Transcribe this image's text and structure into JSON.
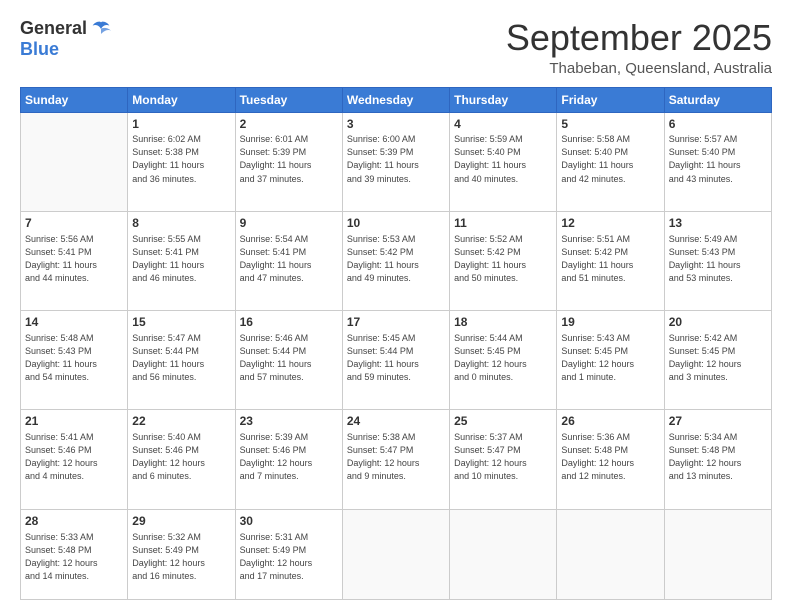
{
  "logo": {
    "general": "General",
    "blue": "Blue"
  },
  "title": "September 2025",
  "location": "Thabeban, Queensland, Australia",
  "days_of_week": [
    "Sunday",
    "Monday",
    "Tuesday",
    "Wednesday",
    "Thursday",
    "Friday",
    "Saturday"
  ],
  "weeks": [
    [
      {
        "day": "",
        "info": ""
      },
      {
        "day": "1",
        "info": "Sunrise: 6:02 AM\nSunset: 5:38 PM\nDaylight: 11 hours\nand 36 minutes."
      },
      {
        "day": "2",
        "info": "Sunrise: 6:01 AM\nSunset: 5:39 PM\nDaylight: 11 hours\nand 37 minutes."
      },
      {
        "day": "3",
        "info": "Sunrise: 6:00 AM\nSunset: 5:39 PM\nDaylight: 11 hours\nand 39 minutes."
      },
      {
        "day": "4",
        "info": "Sunrise: 5:59 AM\nSunset: 5:40 PM\nDaylight: 11 hours\nand 40 minutes."
      },
      {
        "day": "5",
        "info": "Sunrise: 5:58 AM\nSunset: 5:40 PM\nDaylight: 11 hours\nand 42 minutes."
      },
      {
        "day": "6",
        "info": "Sunrise: 5:57 AM\nSunset: 5:40 PM\nDaylight: 11 hours\nand 43 minutes."
      }
    ],
    [
      {
        "day": "7",
        "info": "Sunrise: 5:56 AM\nSunset: 5:41 PM\nDaylight: 11 hours\nand 44 minutes."
      },
      {
        "day": "8",
        "info": "Sunrise: 5:55 AM\nSunset: 5:41 PM\nDaylight: 11 hours\nand 46 minutes."
      },
      {
        "day": "9",
        "info": "Sunrise: 5:54 AM\nSunset: 5:41 PM\nDaylight: 11 hours\nand 47 minutes."
      },
      {
        "day": "10",
        "info": "Sunrise: 5:53 AM\nSunset: 5:42 PM\nDaylight: 11 hours\nand 49 minutes."
      },
      {
        "day": "11",
        "info": "Sunrise: 5:52 AM\nSunset: 5:42 PM\nDaylight: 11 hours\nand 50 minutes."
      },
      {
        "day": "12",
        "info": "Sunrise: 5:51 AM\nSunset: 5:42 PM\nDaylight: 11 hours\nand 51 minutes."
      },
      {
        "day": "13",
        "info": "Sunrise: 5:49 AM\nSunset: 5:43 PM\nDaylight: 11 hours\nand 53 minutes."
      }
    ],
    [
      {
        "day": "14",
        "info": "Sunrise: 5:48 AM\nSunset: 5:43 PM\nDaylight: 11 hours\nand 54 minutes."
      },
      {
        "day": "15",
        "info": "Sunrise: 5:47 AM\nSunset: 5:44 PM\nDaylight: 11 hours\nand 56 minutes."
      },
      {
        "day": "16",
        "info": "Sunrise: 5:46 AM\nSunset: 5:44 PM\nDaylight: 11 hours\nand 57 minutes."
      },
      {
        "day": "17",
        "info": "Sunrise: 5:45 AM\nSunset: 5:44 PM\nDaylight: 11 hours\nand 59 minutes."
      },
      {
        "day": "18",
        "info": "Sunrise: 5:44 AM\nSunset: 5:45 PM\nDaylight: 12 hours\nand 0 minutes."
      },
      {
        "day": "19",
        "info": "Sunrise: 5:43 AM\nSunset: 5:45 PM\nDaylight: 12 hours\nand 1 minute."
      },
      {
        "day": "20",
        "info": "Sunrise: 5:42 AM\nSunset: 5:45 PM\nDaylight: 12 hours\nand 3 minutes."
      }
    ],
    [
      {
        "day": "21",
        "info": "Sunrise: 5:41 AM\nSunset: 5:46 PM\nDaylight: 12 hours\nand 4 minutes."
      },
      {
        "day": "22",
        "info": "Sunrise: 5:40 AM\nSunset: 5:46 PM\nDaylight: 12 hours\nand 6 minutes."
      },
      {
        "day": "23",
        "info": "Sunrise: 5:39 AM\nSunset: 5:46 PM\nDaylight: 12 hours\nand 7 minutes."
      },
      {
        "day": "24",
        "info": "Sunrise: 5:38 AM\nSunset: 5:47 PM\nDaylight: 12 hours\nand 9 minutes."
      },
      {
        "day": "25",
        "info": "Sunrise: 5:37 AM\nSunset: 5:47 PM\nDaylight: 12 hours\nand 10 minutes."
      },
      {
        "day": "26",
        "info": "Sunrise: 5:36 AM\nSunset: 5:48 PM\nDaylight: 12 hours\nand 12 minutes."
      },
      {
        "day": "27",
        "info": "Sunrise: 5:34 AM\nSunset: 5:48 PM\nDaylight: 12 hours\nand 13 minutes."
      }
    ],
    [
      {
        "day": "28",
        "info": "Sunrise: 5:33 AM\nSunset: 5:48 PM\nDaylight: 12 hours\nand 14 minutes."
      },
      {
        "day": "29",
        "info": "Sunrise: 5:32 AM\nSunset: 5:49 PM\nDaylight: 12 hours\nand 16 minutes."
      },
      {
        "day": "30",
        "info": "Sunrise: 5:31 AM\nSunset: 5:49 PM\nDaylight: 12 hours\nand 17 minutes."
      },
      {
        "day": "",
        "info": ""
      },
      {
        "day": "",
        "info": ""
      },
      {
        "day": "",
        "info": ""
      },
      {
        "day": "",
        "info": ""
      }
    ]
  ]
}
